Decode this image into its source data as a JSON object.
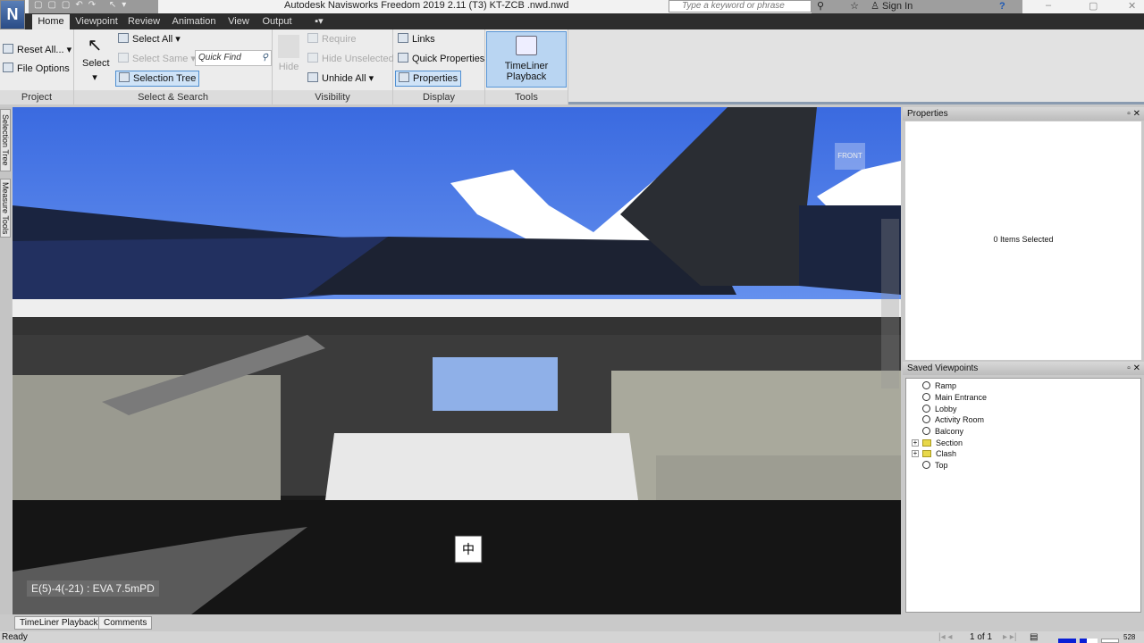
{
  "app": {
    "logo": "N",
    "title": "Autodesk Navisworks Freedom 2019    2.11 (T3) KT-ZCB .nwd.nwd",
    "search_placeholder": "Type a keyword or phrase",
    "sign_in": "Sign In",
    "help": "?"
  },
  "tabs": [
    "Home",
    "Viewpoint",
    "Review",
    "Animation",
    "View",
    "Output"
  ],
  "ribbon": {
    "project": {
      "label": "Project",
      "reset_all": "Reset All...",
      "file_options": "File Options"
    },
    "select_search": {
      "label": "Select & Search",
      "select": "Select",
      "select_all": "Select All",
      "select_same": "Select Same",
      "quick_find": "Quick Find",
      "selection_tree": "Selection Tree"
    },
    "visibility": {
      "label": "Visibility",
      "hide": "Hide",
      "require": "Require",
      "hide_unselected": "Hide Unselected",
      "unhide_all": "Unhide All"
    },
    "display": {
      "label": "Display",
      "links": "Links",
      "quick_properties": "Quick Properties",
      "properties": "Properties"
    },
    "tools": {
      "label": "Tools",
      "timeliner_playback": "TimeLiner Playback"
    }
  },
  "left_tabs": [
    "Selection Tree",
    "Measure Tools"
  ],
  "viewport": {
    "coordinate": "E(5)-4(-21) : EVA 7.5mPD",
    "viewcube": "FRONT"
  },
  "properties": {
    "title": "Properties",
    "empty": "0 Items Selected"
  },
  "saved_viewpoints": {
    "title": "Saved Viewpoints",
    "items": [
      {
        "label": "Ramp",
        "type": "viewpoint"
      },
      {
        "label": "Main Entrance",
        "type": "viewpoint"
      },
      {
        "label": "Lobby",
        "type": "viewpoint"
      },
      {
        "label": "Activity Room",
        "type": "viewpoint"
      },
      {
        "label": "Balcony",
        "type": "viewpoint"
      },
      {
        "label": "Section",
        "type": "folder"
      },
      {
        "label": "Clash",
        "type": "folder"
      },
      {
        "label": "Top",
        "type": "viewpoint"
      }
    ]
  },
  "bottom_tabs": [
    "TimeLiner Playback",
    "Comments"
  ],
  "status": {
    "text": "Ready",
    "page": "1 of 1",
    "memory": "528"
  }
}
